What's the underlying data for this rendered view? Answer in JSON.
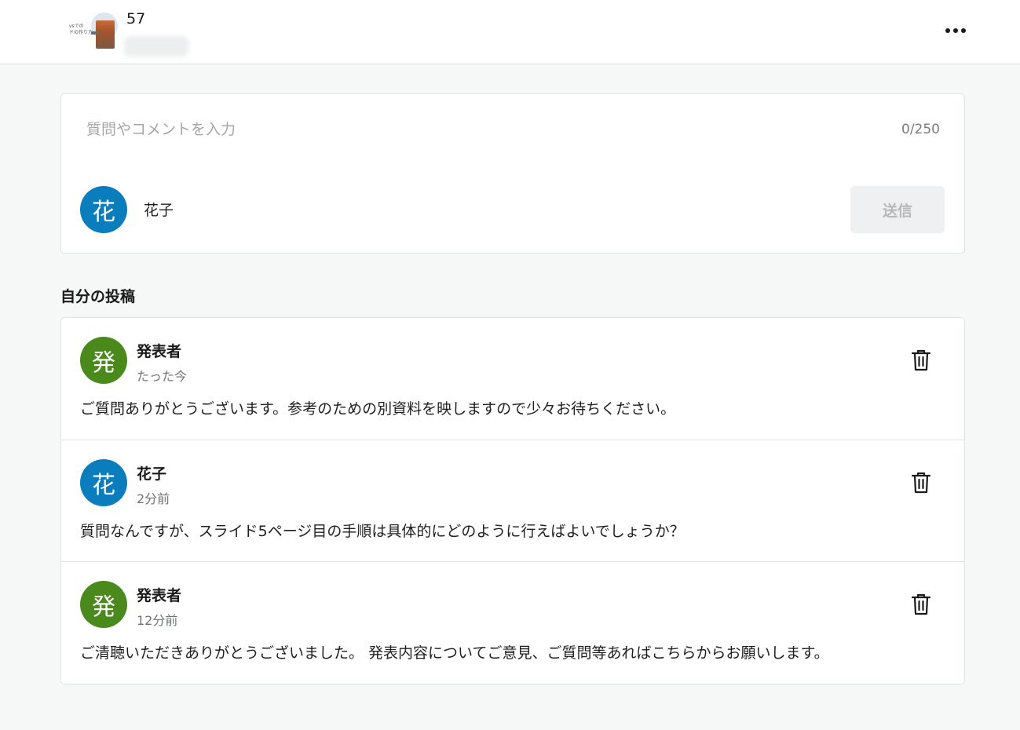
{
  "header": {
    "thumbnail_text": "vsでの\nドの作り方",
    "count": "57",
    "more_icon": "more-horizontal-icon"
  },
  "composer": {
    "placeholder": "質問やコメントを入力",
    "char_count": "0/250",
    "avatar_initial": "花",
    "user_name": "花子",
    "send_label": "送信"
  },
  "section": {
    "title": "自分の投稿"
  },
  "posts": [
    {
      "avatar": "発",
      "avatar_color": "#4a8a1c",
      "author": "発表者",
      "time": "たった今",
      "body": "ご質問ありがとうございます。参考のための別資料を映しますので少々お待ちください。"
    },
    {
      "avatar": "花",
      "avatar_color": "#0a7dbc",
      "author": "花子",
      "time": "2分前",
      "body": "質問なんですが、スライド5ページ目の手順は具体的にどのように行えばよいでしょうか？"
    },
    {
      "avatar": "発",
      "avatar_color": "#4a8a1c",
      "author": "発表者",
      "time": "12分前",
      "body": "ご清聴いただきありがとうございました。 発表内容についてご意見、ご質問等あればこちらからお願いします。"
    }
  ],
  "colors": {
    "accent_blue": "#0a7dbc",
    "accent_green": "#4a8a1c",
    "page_bg": "#f6f7f7"
  }
}
